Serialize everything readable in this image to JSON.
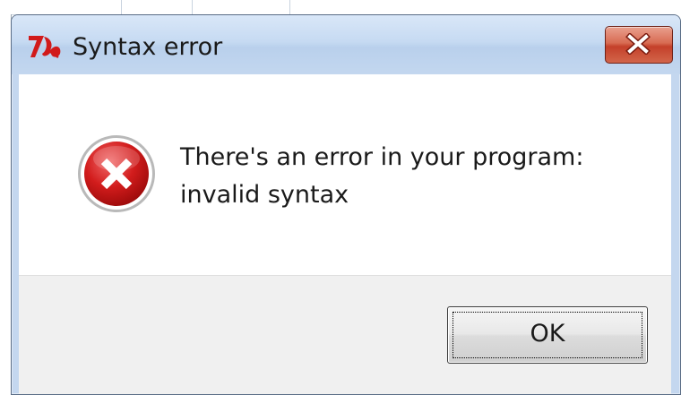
{
  "window": {
    "title": "Syntax error",
    "app_icon": "tk-feather-icon",
    "close_icon": "close-icon"
  },
  "message": {
    "icon": "error-icon",
    "line1": "There's an error in your program:",
    "line2": "invalid syntax"
  },
  "buttons": {
    "ok_label": "OK"
  },
  "colors": {
    "title_bar": "#c6daf2",
    "close_button": "#c4402a",
    "error_icon": "#c8102e",
    "button_area": "#f0f0f0"
  }
}
